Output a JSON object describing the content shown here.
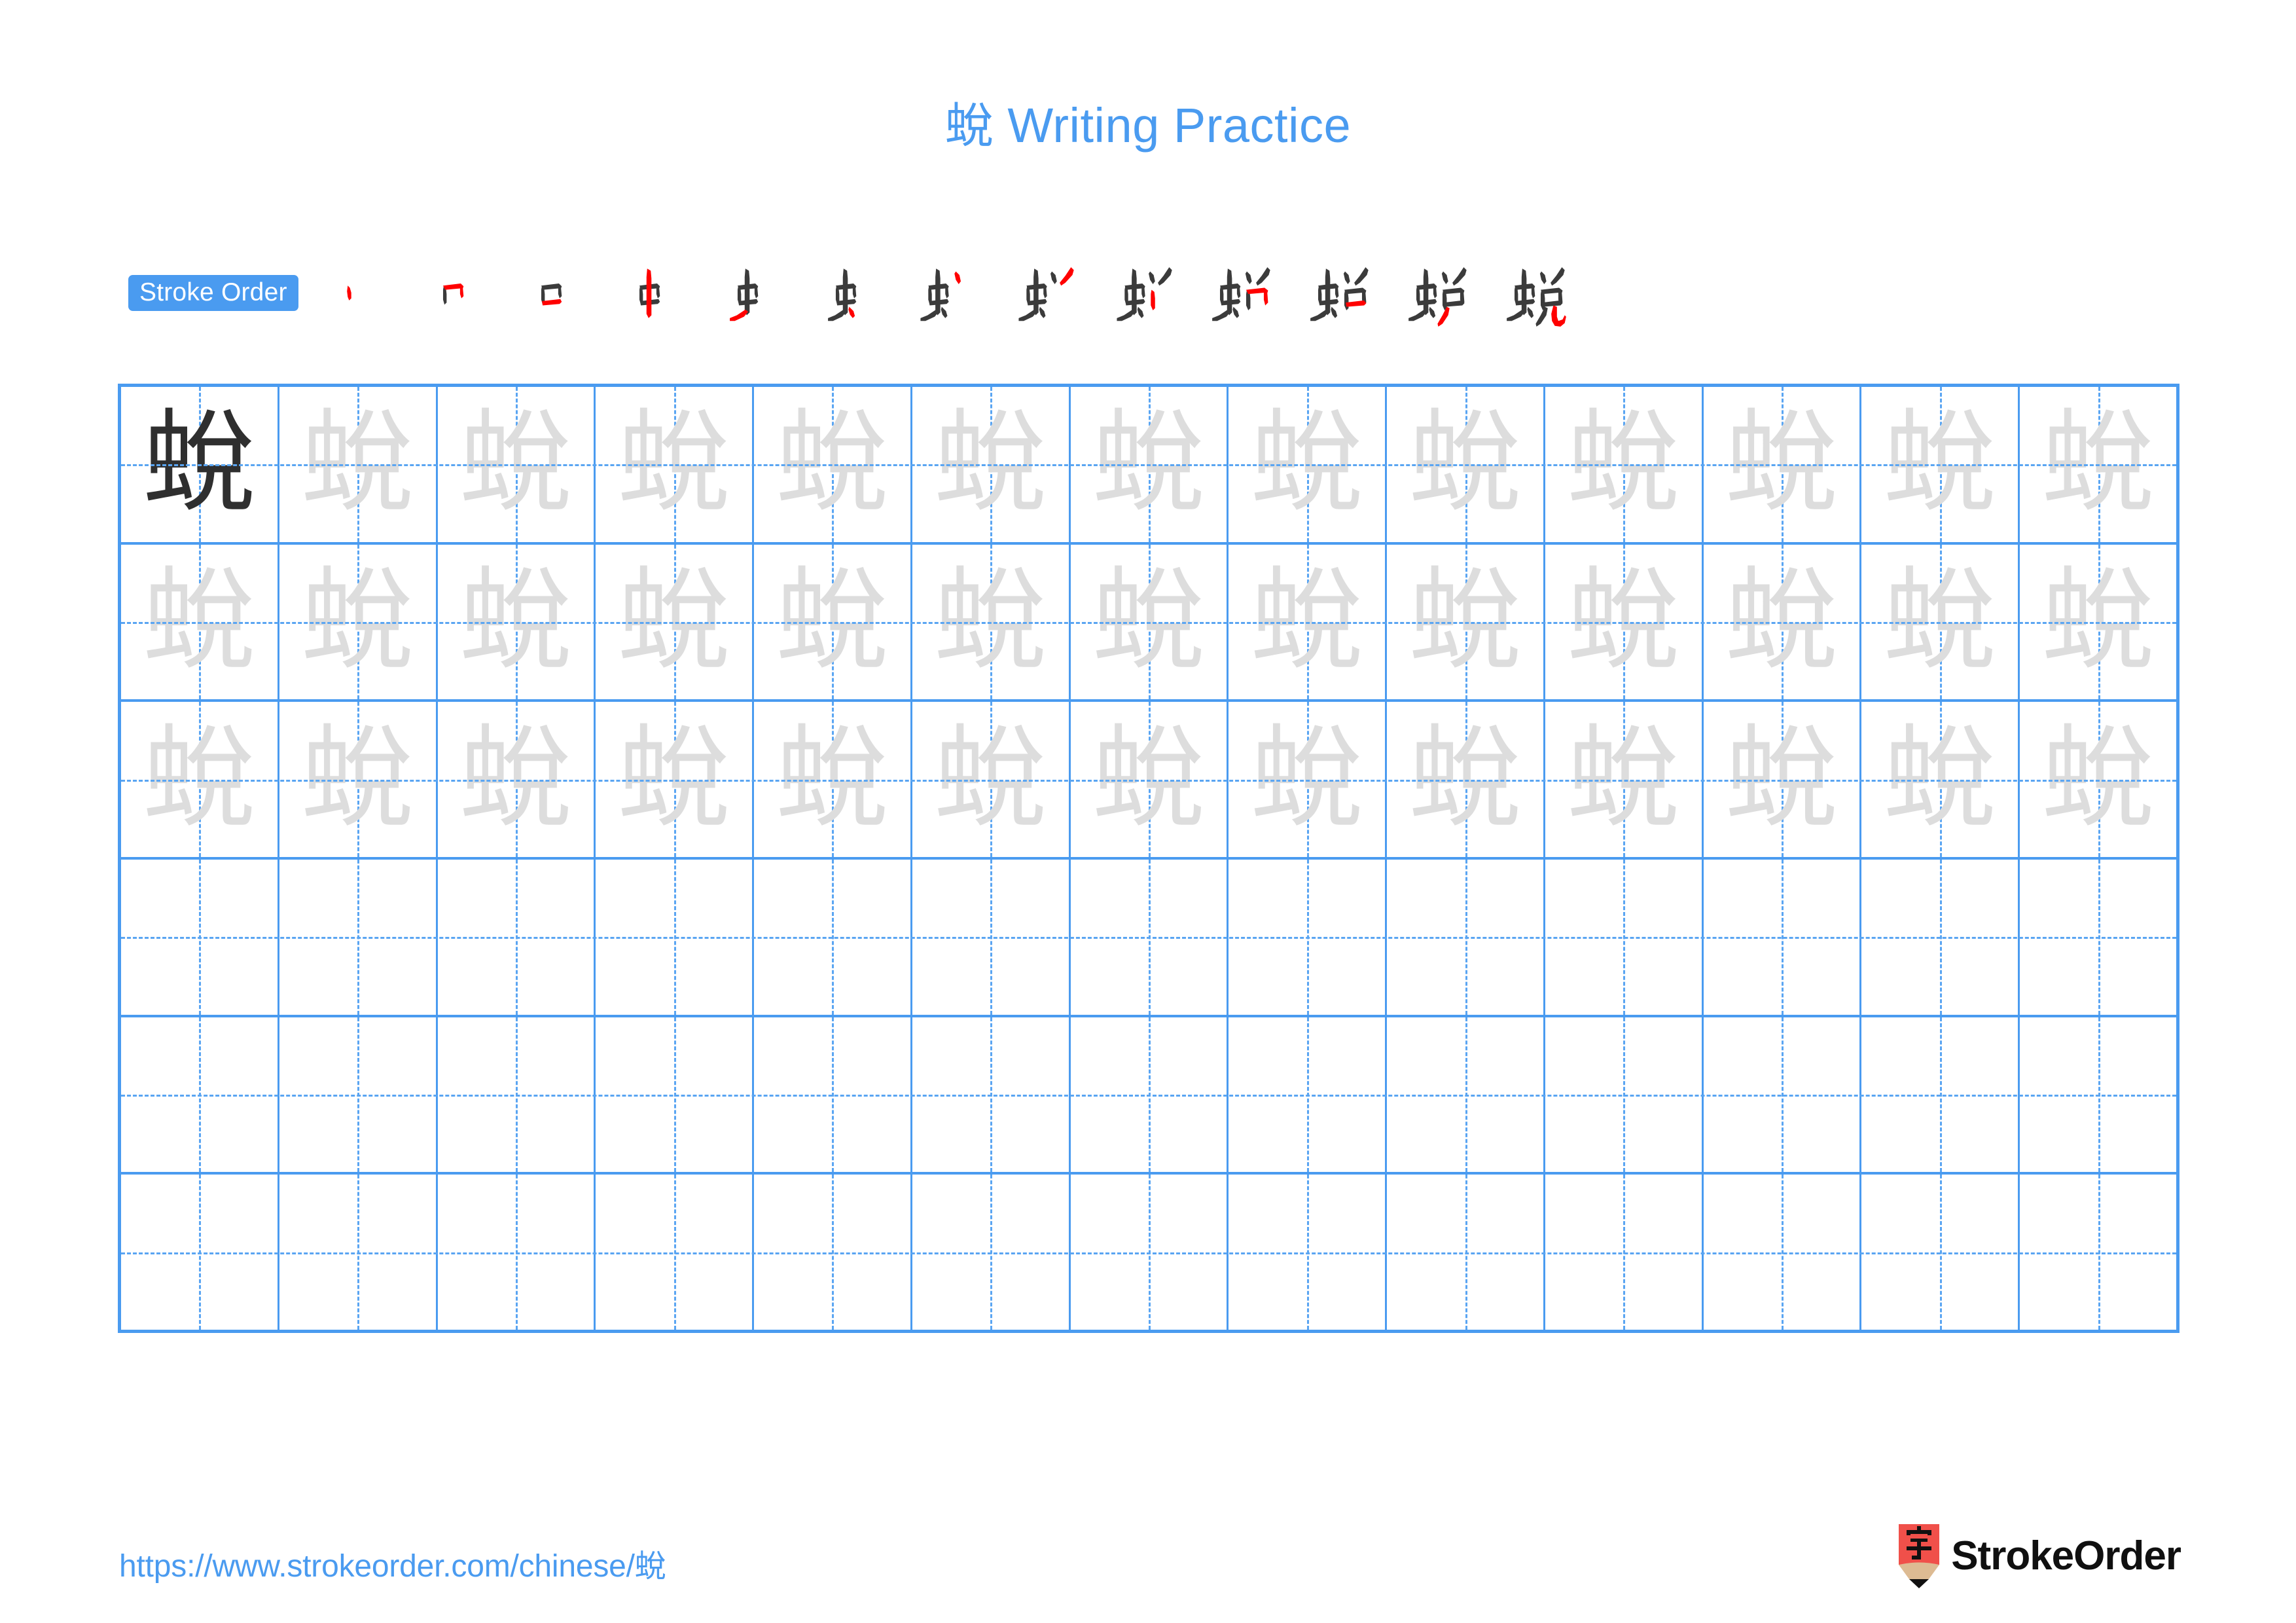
{
  "document": {
    "character": "蛻",
    "title": "蛻 Writing Practice",
    "type": "chinese-character-writing-practice-worksheet"
  },
  "header": {
    "title": "蛻 Writing Practice",
    "title_color": "#4a9bf0"
  },
  "stroke_order": {
    "badge_label": "Stroke Order",
    "badge_bg": "#4a9bf0",
    "badge_text_color": "#ffffff",
    "total_strokes": 13,
    "completed_stroke_color": "#3b3b3b",
    "new_stroke_color": "#ff0000",
    "steps": [
      {
        "index": 1,
        "partial": "丶",
        "new_stroke": "丶 (dot / left vertical of 口)"
      },
      {
        "index": 2,
        "partial": "冂",
        "new_stroke": "𠃍 (horizontal-turn)"
      },
      {
        "index": 3,
        "partial": "口",
        "new_stroke": "一 (bottom horizontal)"
      },
      {
        "index": 4,
        "partial": "中",
        "new_stroke": "丨 (long vertical)"
      },
      {
        "index": 5,
        "partial": "virtual-5",
        "new_stroke": "㇀ (rising stroke)"
      },
      {
        "index": 6,
        "partial": "虫",
        "new_stroke": "丶 (final dot of 虫)"
      },
      {
        "index": 7,
        "partial": "虫丶",
        "new_stroke": "丶 (left dot of 兑 top)"
      },
      {
        "index": 8,
        "partial": "虫丷",
        "new_stroke": "丿 (right stroke of 兑 top)"
      },
      {
        "index": 9,
        "partial": "虫丷丨",
        "new_stroke": "丨 (left vertical of 口)"
      },
      {
        "index": 10,
        "partial": "蚀-10",
        "new_stroke": "𠃌 (turn stroke)"
      },
      {
        "index": 11,
        "partial": "蛻-11",
        "new_stroke": "一 (horizontal inside 口)"
      },
      {
        "index": 12,
        "partial": "蛻-12",
        "new_stroke": "丿 (left falling)"
      },
      {
        "index": 13,
        "partial": "蛻",
        "new_stroke": "乚 (final hook)"
      }
    ]
  },
  "practice_grid": {
    "columns": 13,
    "rows": 6,
    "grid_line_color": "#4a9bf0",
    "guide_line_color": "#5aa5f2",
    "model_char_color": "#2f2f2f",
    "trace_char_color": "#dddddd",
    "rows_data": [
      {
        "row": 1,
        "cells": [
          {
            "char": "蛻",
            "style": "dark"
          },
          {
            "char": "蛻",
            "style": "faint"
          },
          {
            "char": "蛻",
            "style": "faint"
          },
          {
            "char": "蛻",
            "style": "faint"
          },
          {
            "char": "蛻",
            "style": "faint"
          },
          {
            "char": "蛻",
            "style": "faint"
          },
          {
            "char": "蛻",
            "style": "faint"
          },
          {
            "char": "蛻",
            "style": "faint"
          },
          {
            "char": "蛻",
            "style": "faint"
          },
          {
            "char": "蛻",
            "style": "faint"
          },
          {
            "char": "蛻",
            "style": "faint"
          },
          {
            "char": "蛻",
            "style": "faint"
          },
          {
            "char": "蛻",
            "style": "faint"
          }
        ]
      },
      {
        "row": 2,
        "cells": [
          {
            "char": "蛻",
            "style": "faint"
          },
          {
            "char": "蛻",
            "style": "faint"
          },
          {
            "char": "蛻",
            "style": "faint"
          },
          {
            "char": "蛻",
            "style": "faint"
          },
          {
            "char": "蛻",
            "style": "faint"
          },
          {
            "char": "蛻",
            "style": "faint"
          },
          {
            "char": "蛻",
            "style": "faint"
          },
          {
            "char": "蛻",
            "style": "faint"
          },
          {
            "char": "蛻",
            "style": "faint"
          },
          {
            "char": "蛻",
            "style": "faint"
          },
          {
            "char": "蛻",
            "style": "faint"
          },
          {
            "char": "蛻",
            "style": "faint"
          },
          {
            "char": "蛻",
            "style": "faint"
          }
        ]
      },
      {
        "row": 3,
        "cells": [
          {
            "char": "蛻",
            "style": "faint"
          },
          {
            "char": "蛻",
            "style": "faint"
          },
          {
            "char": "蛻",
            "style": "faint"
          },
          {
            "char": "蛻",
            "style": "faint"
          },
          {
            "char": "蛻",
            "style": "faint"
          },
          {
            "char": "蛻",
            "style": "faint"
          },
          {
            "char": "蛻",
            "style": "faint"
          },
          {
            "char": "蛻",
            "style": "faint"
          },
          {
            "char": "蛻",
            "style": "faint"
          },
          {
            "char": "蛻",
            "style": "faint"
          },
          {
            "char": "蛻",
            "style": "faint"
          },
          {
            "char": "蛻",
            "style": "faint"
          },
          {
            "char": "蛻",
            "style": "faint"
          }
        ]
      },
      {
        "row": 4,
        "cells": [
          {
            "char": "",
            "style": "blank"
          },
          {
            "char": "",
            "style": "blank"
          },
          {
            "char": "",
            "style": "blank"
          },
          {
            "char": "",
            "style": "blank"
          },
          {
            "char": "",
            "style": "blank"
          },
          {
            "char": "",
            "style": "blank"
          },
          {
            "char": "",
            "style": "blank"
          },
          {
            "char": "",
            "style": "blank"
          },
          {
            "char": "",
            "style": "blank"
          },
          {
            "char": "",
            "style": "blank"
          },
          {
            "char": "",
            "style": "blank"
          },
          {
            "char": "",
            "style": "blank"
          },
          {
            "char": "",
            "style": "blank"
          }
        ]
      },
      {
        "row": 5,
        "cells": [
          {
            "char": "",
            "style": "blank"
          },
          {
            "char": "",
            "style": "blank"
          },
          {
            "char": "",
            "style": "blank"
          },
          {
            "char": "",
            "style": "blank"
          },
          {
            "char": "",
            "style": "blank"
          },
          {
            "char": "",
            "style": "blank"
          },
          {
            "char": "",
            "style": "blank"
          },
          {
            "char": "",
            "style": "blank"
          },
          {
            "char": "",
            "style": "blank"
          },
          {
            "char": "",
            "style": "blank"
          },
          {
            "char": "",
            "style": "blank"
          },
          {
            "char": "",
            "style": "blank"
          },
          {
            "char": "",
            "style": "blank"
          }
        ]
      },
      {
        "row": 6,
        "cells": [
          {
            "char": "",
            "style": "blank"
          },
          {
            "char": "",
            "style": "blank"
          },
          {
            "char": "",
            "style": "blank"
          },
          {
            "char": "",
            "style": "blank"
          },
          {
            "char": "",
            "style": "blank"
          },
          {
            "char": "",
            "style": "blank"
          },
          {
            "char": "",
            "style": "blank"
          },
          {
            "char": "",
            "style": "blank"
          },
          {
            "char": "",
            "style": "blank"
          },
          {
            "char": "",
            "style": "blank"
          },
          {
            "char": "",
            "style": "blank"
          },
          {
            "char": "",
            "style": "blank"
          },
          {
            "char": "",
            "style": "blank"
          }
        ]
      }
    ]
  },
  "footer": {
    "url": "https://www.strokeorder.com/chinese/蛻",
    "url_color": "#4a9bf0",
    "brand_name": "StrokeOrder",
    "brand_icon_char": "字",
    "brand_icon_bg": "#f0504a",
    "brand_icon_wood": "#ddbb93",
    "brand_icon_tip": "#111111"
  }
}
